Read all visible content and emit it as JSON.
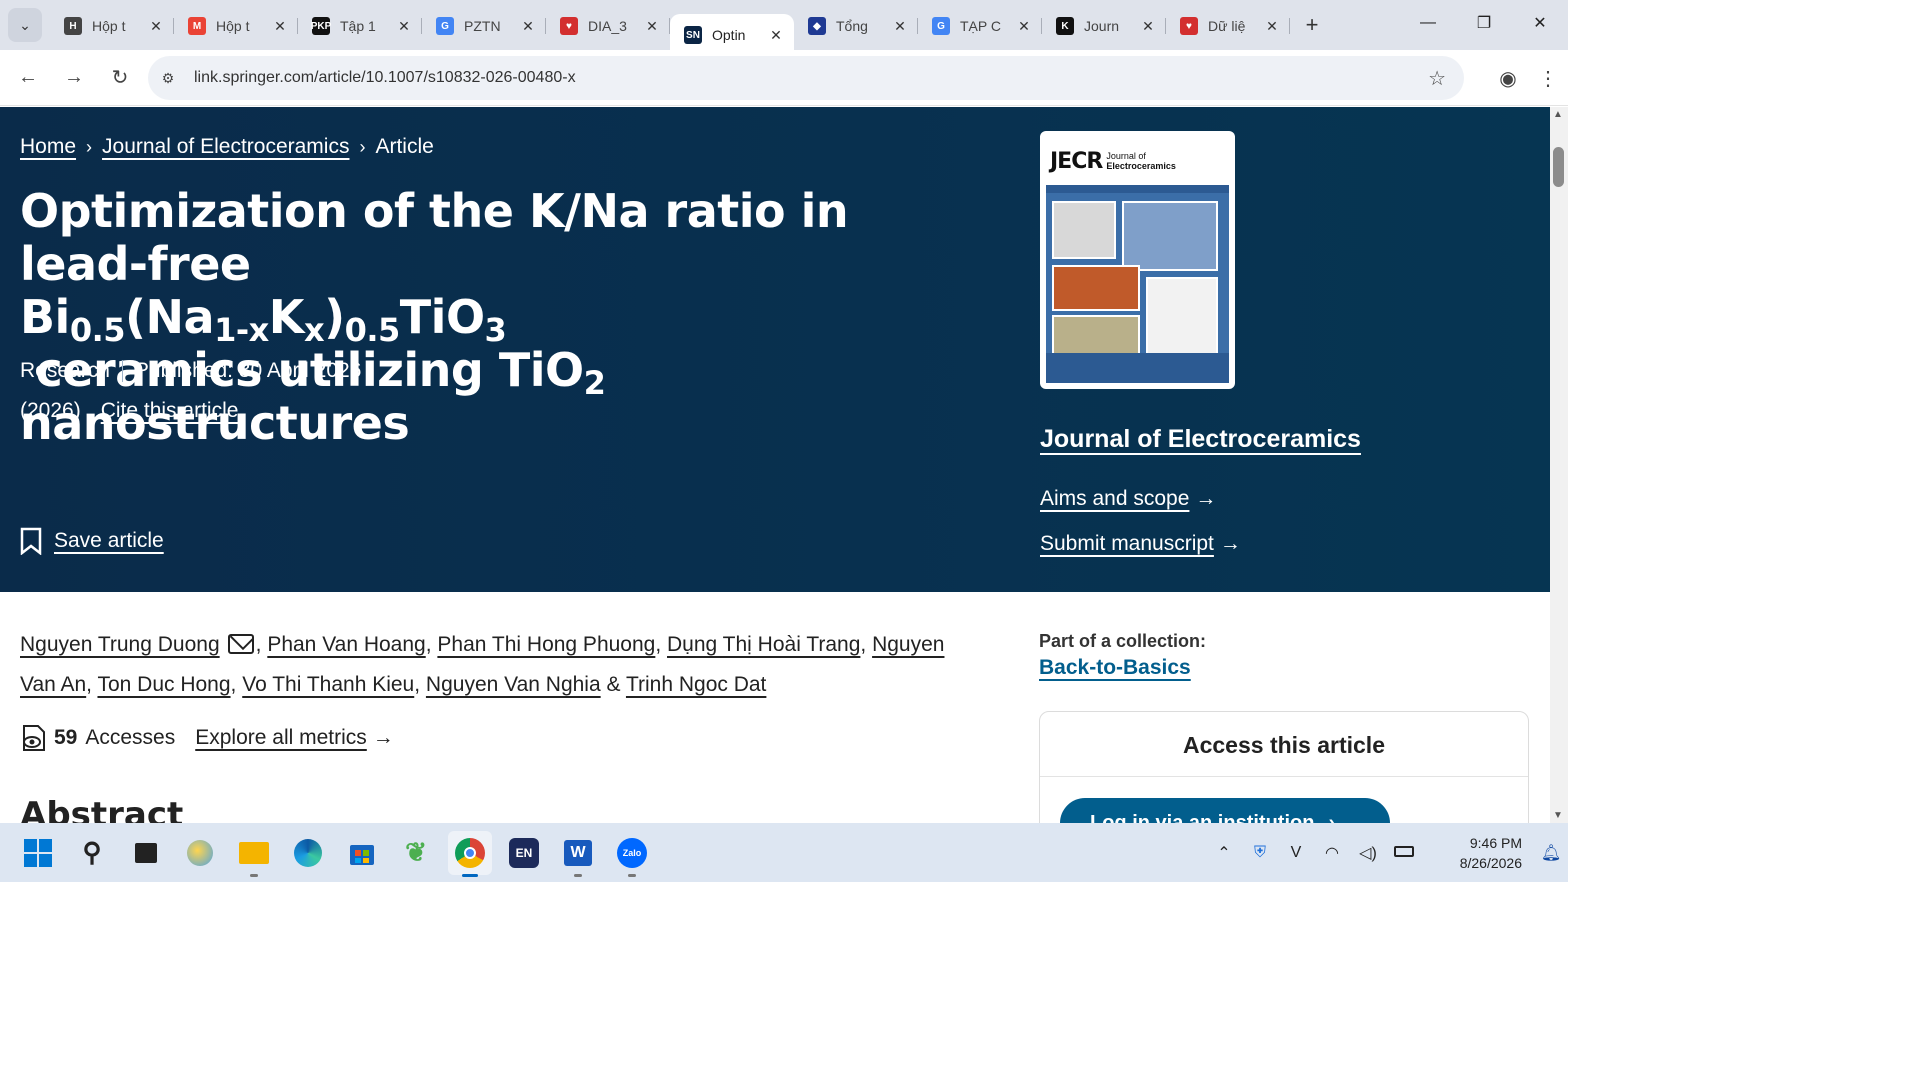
{
  "browser": {
    "tab_list_icon": "chevron-down-icon",
    "tabs": [
      {
        "label": "Hộp t",
        "favicon": "H",
        "color": "#444444",
        "active": false
      },
      {
        "label": "Hộp t",
        "favicon": "M",
        "color": "#ea4335",
        "active": false
      },
      {
        "label": "Tập 1",
        "favicon": "PKP",
        "color": "#111111",
        "active": false
      },
      {
        "label": "PZTN",
        "favicon": "G",
        "color": "#4285f4",
        "active": false
      },
      {
        "label": "DIA_3",
        "favicon": "♥",
        "color": "#d32f2f",
        "active": false
      },
      {
        "label": "Optin",
        "favicon": "SN",
        "color": "#0b2545",
        "active": true
      },
      {
        "label": "Tổng",
        "favicon": "◆",
        "color": "#1f3a93",
        "active": false
      },
      {
        "label": "TẠP C",
        "favicon": "G",
        "color": "#4285f4",
        "active": false
      },
      {
        "label": "Journ",
        "favicon": "K",
        "color": "#111111",
        "active": false
      },
      {
        "label": "Dữ liệ",
        "favicon": "♥",
        "color": "#d32f2f",
        "active": false
      }
    ],
    "new_tab": "+",
    "window_controls": {
      "minimize": "—",
      "restore": "❐",
      "close": "✕"
    },
    "url": "link.springer.com/article/10.1007/s10832-026-00480-x"
  },
  "breadcrumb": {
    "home": "Home",
    "journal": "Journal of Electroceramics",
    "current": "Article"
  },
  "article": {
    "title_line1": "Optimization of the K/Na ratio in lead-free",
    "title_bi": "Bi",
    "title_sub1": "0.5",
    "title_na": "(Na",
    "title_sub2": "1-x",
    "title_k": "K",
    "title_sub3": "x",
    "title_paren": ")",
    "title_sub4": "0.5",
    "title_tio": "TiO",
    "title_sub5": "3",
    "title_mid": " ceramics utilizing TiO",
    "title_sub6": "2",
    "title_line3": "nanostructures",
    "type": "Research",
    "published": "Published: 30 April 2026",
    "year": "(2026)",
    "cite": "Cite this article",
    "save": "Save article"
  },
  "journal_panel": {
    "cover_title": "JECR",
    "cover_subtitle_1": "Journal of",
    "cover_subtitle_2": "Electroceramics",
    "name": "Journal of Electroceramics",
    "aims": "Aims and scope",
    "submit": "Submit manuscript"
  },
  "authors": [
    "Nguyen Trung Duong",
    "Phan Van Hoang",
    "Phan Thi Hong Phuong",
    "Dụng Thị Hoài Trang",
    "Nguyen Van An",
    "Ton Duc Hong",
    "Vo Thi Thanh Kieu",
    "Nguyen Van Nghia",
    "Trinh Ngoc Dat"
  ],
  "metrics": {
    "count": "59",
    "label": "Accesses",
    "explore": "Explore all metrics"
  },
  "abstract_heading": "Abstract",
  "collection": {
    "label": "Part of a collection:",
    "name": "Back-to-Basics"
  },
  "access": {
    "heading": "Access this article",
    "button": "Log in via an institution"
  },
  "taskbar": {
    "language": "EN",
    "time": "9:46 PM",
    "date": "8/26/2026"
  }
}
